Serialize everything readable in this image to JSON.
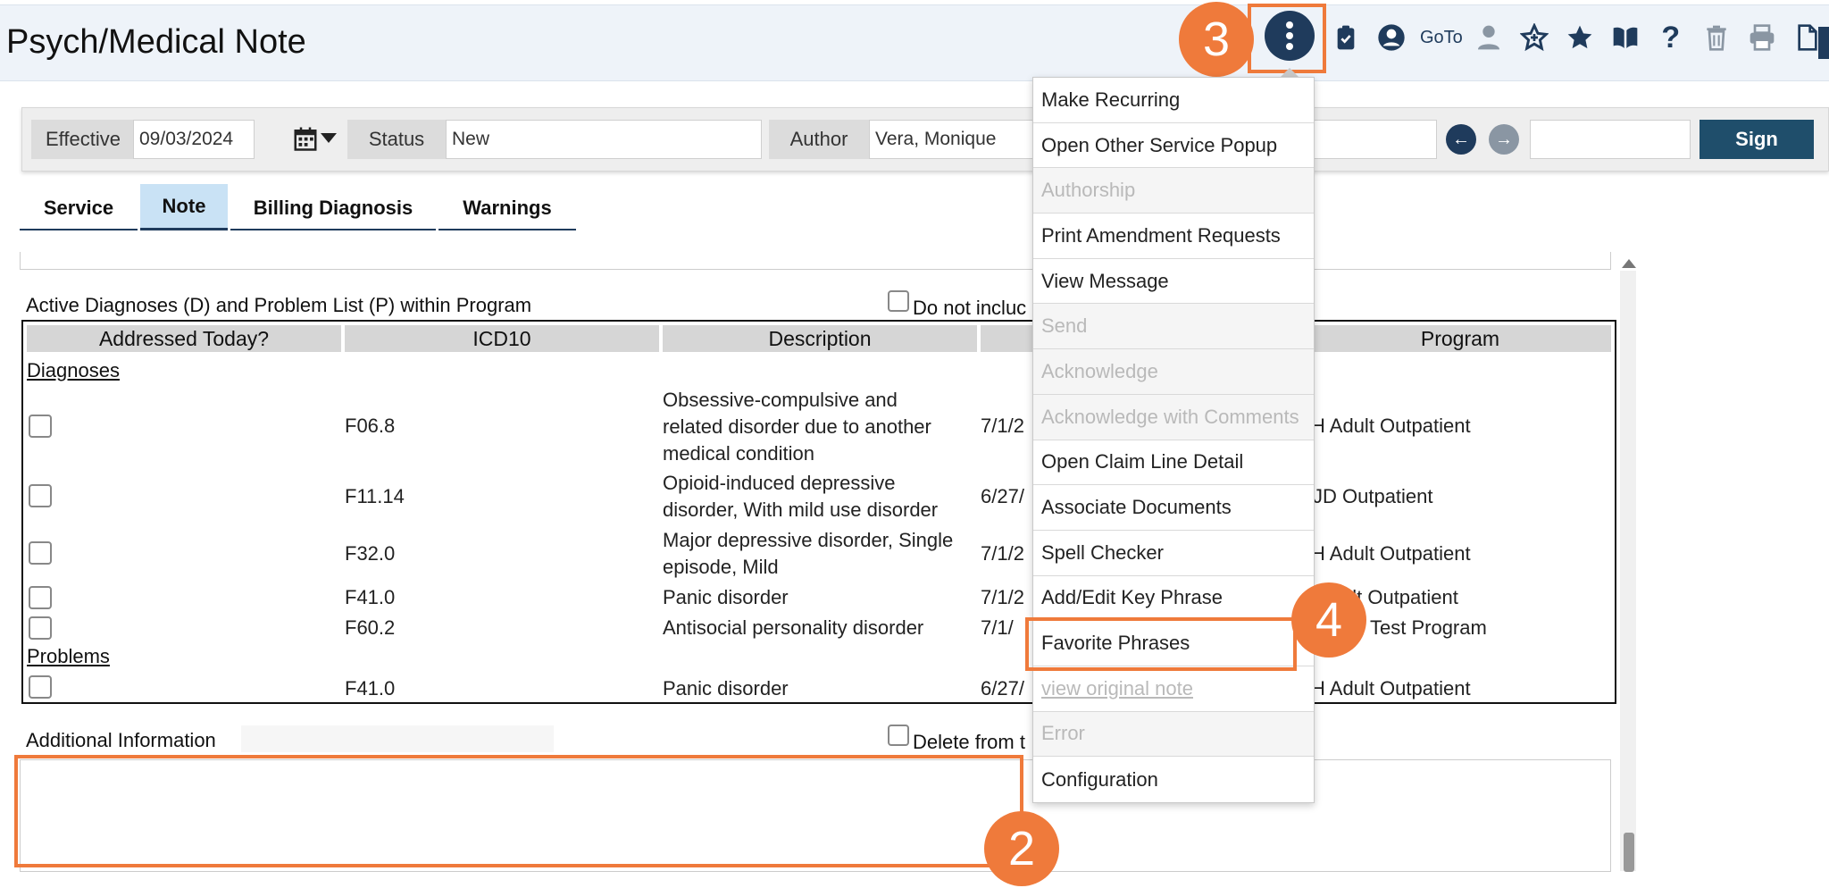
{
  "header": {
    "title": "Psych/Medical Note",
    "goto_label": "GoTo",
    "icons": [
      "kebab-menu-icon",
      "clipboard-check-icon",
      "user-circle-icon",
      "person-icon",
      "star-outline-icon",
      "star-icon",
      "book-icon",
      "help-icon",
      "trash-icon",
      "print-icon",
      "document-icon"
    ]
  },
  "callouts": {
    "c2": "2",
    "c3": "3",
    "c4": "4"
  },
  "toolbar": {
    "effective_label": "Effective",
    "effective_value": "09/03/2024",
    "status_label": "Status",
    "status_value": "New",
    "author_label": "Author",
    "author_value": "Vera, Monique",
    "sign_label": "Sign"
  },
  "tabs": [
    "Service",
    "Note",
    "Billing Diagnosis",
    "Warnings"
  ],
  "diagnoses_section": {
    "title": "Active Diagnoses (D) and Problem List (P) within Program",
    "checkbox_label": "Do not incluc",
    "columns": [
      "Addressed Today?",
      "ICD10",
      "Description",
      "Program"
    ],
    "group_diagnoses": "Diagnoses",
    "group_problems": "Problems",
    "rows": [
      {
        "icd": "F06.8",
        "desc": [
          "Obsessive-compulsive and",
          "related disorder due to another",
          "medical condition"
        ],
        "date": "7/1/2",
        "program": "H Adult Outpatient"
      },
      {
        "icd": "F11.14",
        "desc": [
          "Opioid-induced depressive",
          "disorder, With mild use disorder"
        ],
        "date": "6/27/",
        "program": "JD Outpatient"
      },
      {
        "icd": "F32.0",
        "desc": [
          "Major depressive disorder, Single",
          "episode, Mild"
        ],
        "date": "7/1/2",
        "program": "H Adult Outpatient"
      },
      {
        "icd": "F41.0",
        "desc": [
          "Panic disorder"
        ],
        "date": "7/1/2",
        "program": "ult Outpatient"
      },
      {
        "icd": "F60.2",
        "desc": [
          "Antisocial personality disorder"
        ],
        "date": "7/1/",
        "program": "Test Program"
      },
      {
        "icd": "F41.0",
        "desc": [
          "Panic disorder"
        ],
        "date": "6/27/",
        "program": "H Adult Outpatient"
      }
    ]
  },
  "additional_info": {
    "title": "Additional Information",
    "checkbox_label": "Delete from t"
  },
  "menu": {
    "items": [
      {
        "label": "Make Recurring",
        "disabled": false
      },
      {
        "label": "Open Other Service Popup",
        "disabled": false
      },
      {
        "label": "Authorship",
        "disabled": true
      },
      {
        "label": "Print Amendment Requests",
        "disabled": false
      },
      {
        "label": "View Message",
        "disabled": false
      },
      {
        "label": "Send",
        "disabled": true
      },
      {
        "label": "Acknowledge",
        "disabled": true
      },
      {
        "label": "Acknowledge with Comments",
        "disabled": true
      },
      {
        "label": "Open Claim Line Detail",
        "disabled": false
      },
      {
        "label": "Associate Documents",
        "disabled": false
      },
      {
        "label": "Spell Checker",
        "disabled": false
      },
      {
        "label": "Add/Edit Key Phrase",
        "disabled": false
      },
      {
        "label": "Favorite Phrases",
        "disabled": false
      },
      {
        "label": "view original note",
        "disabled": true
      },
      {
        "label": "Error",
        "disabled": true
      },
      {
        "label": "Configuration",
        "disabled": false
      }
    ]
  },
  "colors": {
    "accent": "#ef7a3b",
    "navy": "#1f3b5c",
    "header_bg": "#eef3f9",
    "tab_active": "#c9e2f5"
  }
}
